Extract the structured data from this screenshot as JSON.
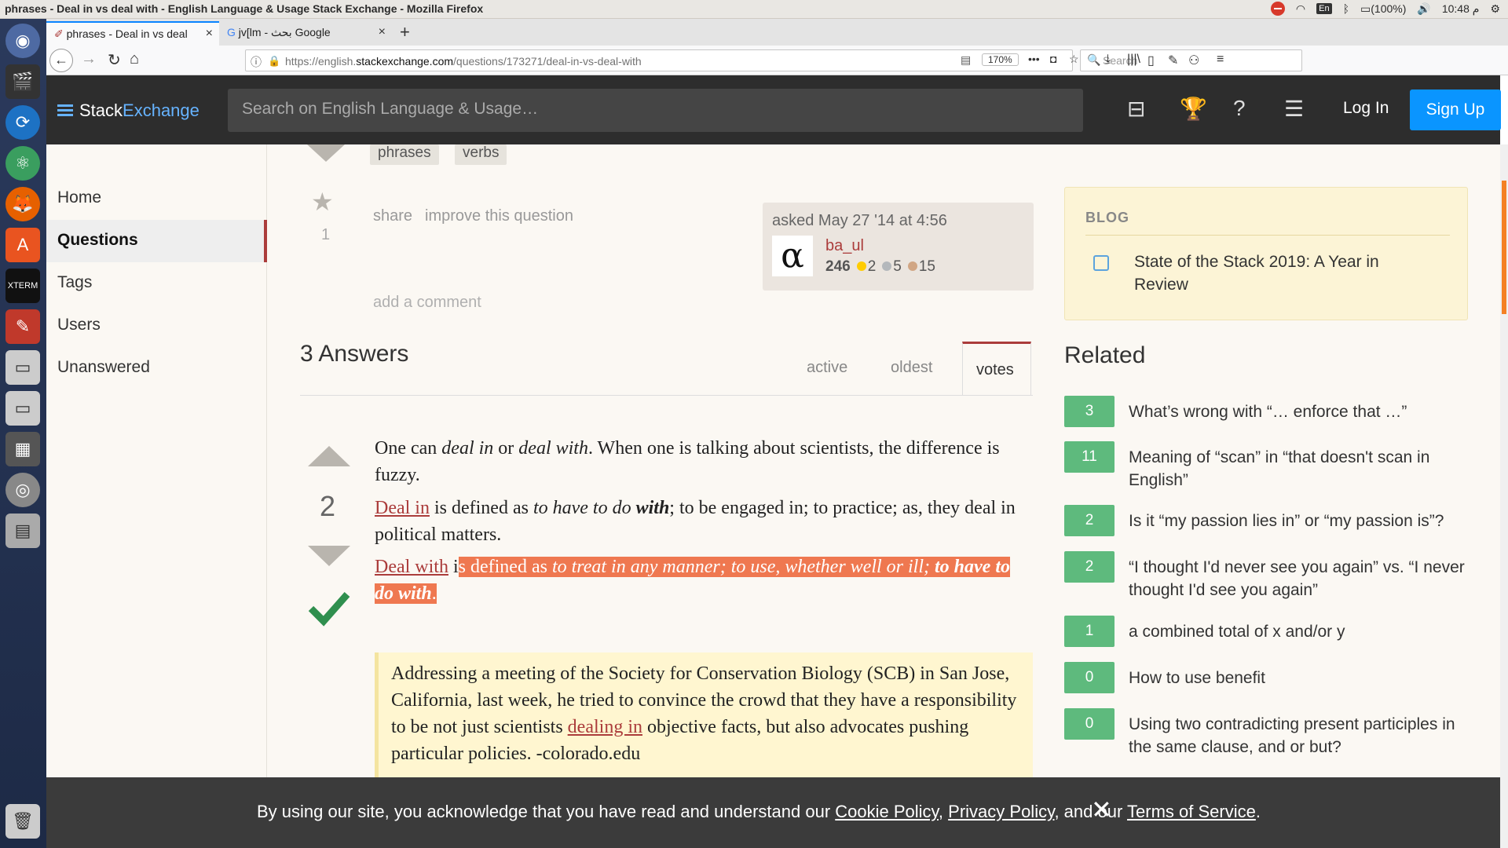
{
  "window_title": "phrases - Deal in vs deal with - English Language & Usage Stack Exchange - Mozilla Firefox",
  "os": {
    "lang": "En",
    "battery": "(100%)",
    "clock": "10:48 م"
  },
  "tabs": [
    {
      "label": "phrases - Deal in vs deal"
    },
    {
      "label": "jv[lm - بحث Google"
    }
  ],
  "url": {
    "prefix": "https://english.",
    "domain": "stackexchange.com",
    "path": "/questions/173271/deal-in-vs-deal-with"
  },
  "zoom": "170%",
  "browser_search_placeholder": "Search",
  "se": {
    "logo_a": "Stack",
    "logo_b": "Exchange",
    "search_placeholder": "Search on English Language & Usage…",
    "login": "Log In",
    "signup": "Sign Up"
  },
  "nav": [
    "Home",
    "Questions",
    "Tags",
    "Users",
    "Unanswered"
  ],
  "question": {
    "tags": [
      "phrases",
      "verbs"
    ],
    "favorites": "1",
    "share": "share",
    "improve": "improve this question",
    "add_comment": "add a comment",
    "asked": "asked May 27 '14 at 4:56",
    "avatar": "α",
    "user": "ba_ul",
    "rep": "246",
    "gold": "2",
    "silver": "5",
    "bronze": "15"
  },
  "answers": {
    "header": "3 Answers",
    "sort": [
      "active",
      "oldest",
      "votes"
    ],
    "vote_count": "2",
    "p1": {
      "a": "One can ",
      "b": "deal in",
      "c": " or ",
      "d": "deal with",
      "e": ". When one is talking about scientists, the difference is fuzzy."
    },
    "p2": {
      "link": "Deal in",
      "a": " is defined as ",
      "b": "to have to do ",
      "c": "with",
      "d": "; to be engaged in; to practice; as, they deal in political matters."
    },
    "p3": {
      "link": "Deal with",
      "a": " i",
      "b": "s defined as ",
      "c": "to treat in any manner; to use, whether well or ill; ",
      "d": "to have to do with",
      "e": "."
    },
    "quote": {
      "a": "Addressing a meeting of the Society for Conservation Biology (SCB) in San Jose, California, last week, he tried to convince the crowd that they have a responsibility to be not just scientists ",
      "link": "dealing in",
      "b": " objective facts, but also advocates pushing particular policies. -colorado.edu"
    }
  },
  "blog": {
    "heading": "BLOG",
    "item": "State of the Stack 2019: A Year in Review"
  },
  "related": {
    "heading": "Related",
    "items": [
      {
        "score": "3",
        "title": "What’s wrong with “… enforce that …”"
      },
      {
        "score": "11",
        "title": "Meaning of “scan” in “that doesn't scan in English”"
      },
      {
        "score": "2",
        "title": "Is it “my passion lies in” or “my passion is”?"
      },
      {
        "score": "2",
        "title": "“I thought I'd never see you again” vs. “I never thought I'd see you again”"
      },
      {
        "score": "1",
        "title": "a combined total of x and/or y"
      },
      {
        "score": "0",
        "title": "How to use benefit"
      },
      {
        "score": "0",
        "title": "Using two contradicting present participles in the same clause, and or but?"
      }
    ]
  },
  "cookie": {
    "a": "By using our site, you acknowledge that you have read and understand our ",
    "cookie_link": "Cookie Policy",
    "b": ", ",
    "privacy_link": "Privacy Policy",
    "c": ", and our ",
    "terms_link": "Terms of Service",
    "d": ".",
    "close": "✕"
  },
  "colors": {
    "accent": "#ab3c3b",
    "signup": "#0a95ff",
    "badge": "#5eba7d",
    "highlight": "#ef7850"
  }
}
